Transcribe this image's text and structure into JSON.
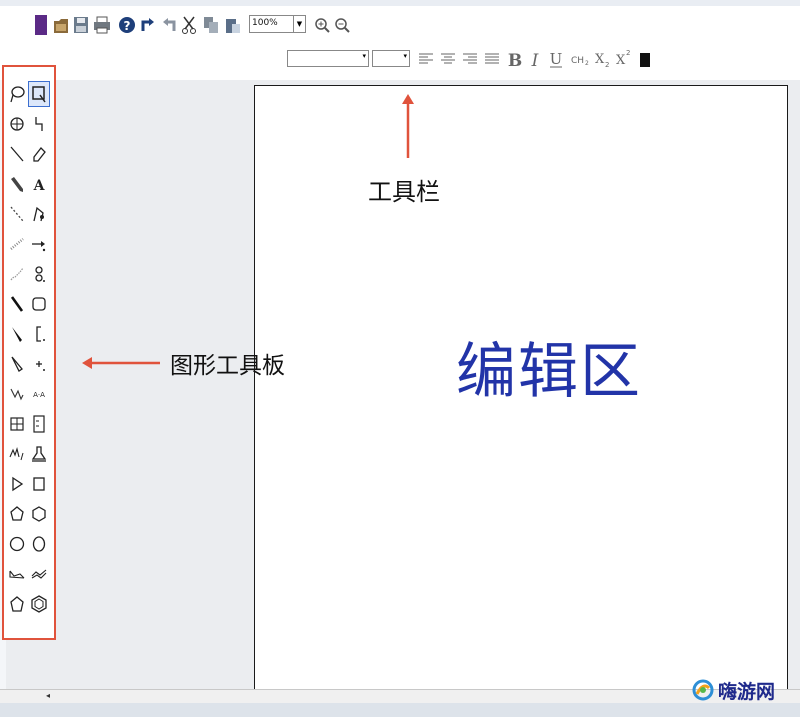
{
  "toolbar": {
    "zoom_value": "100%"
  },
  "annotations": {
    "toolbar_label": "工具栏",
    "palette_label": "图形工具板",
    "editor_label": "编辑区"
  },
  "watermark": {
    "text": "嗨游网"
  },
  "colors": {
    "annotation_red": "#e0533c",
    "editor_text_blue": "#2234a8",
    "canvas_gray": "#ebedf0"
  }
}
